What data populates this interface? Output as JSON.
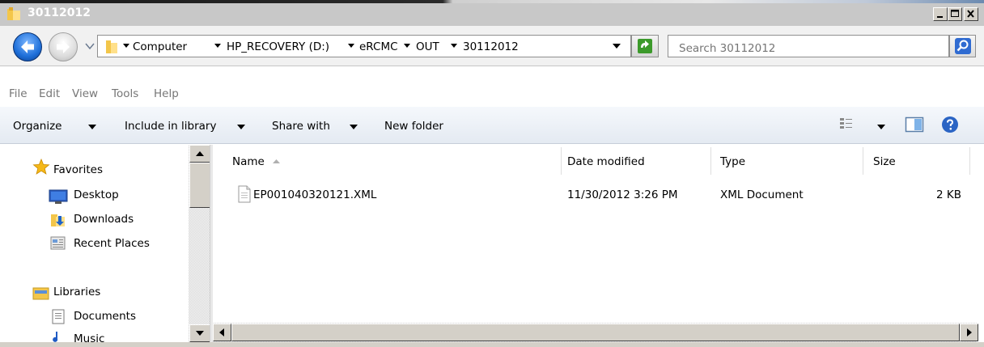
{
  "window": {
    "title": "30112012"
  },
  "address_bar": {
    "crumbs": [
      "Computer",
      "HP_RECOVERY (D:)",
      "eRCMC",
      "OUT",
      "30112012"
    ]
  },
  "search": {
    "placeholder": "Search 30112012"
  },
  "menu": [
    "File",
    "Edit",
    "View",
    "Tools",
    "Help"
  ],
  "commands": {
    "organize": "Organize",
    "include": "Include in library",
    "share": "Share with",
    "new_folder": "New folder"
  },
  "nav": {
    "favorites": "Favorites",
    "desktop": "Desktop",
    "downloads": "Downloads",
    "recent": "Recent Places",
    "libraries": "Libraries",
    "documents": "Documents",
    "music": "Music"
  },
  "columns": {
    "name": "Name",
    "date": "Date modified",
    "type": "Type",
    "size": "Size"
  },
  "files": [
    {
      "name": "EP001040320121.XML",
      "date": "11/30/2012 3:26 PM",
      "type": "XML Document",
      "size": "2 KB"
    }
  ]
}
